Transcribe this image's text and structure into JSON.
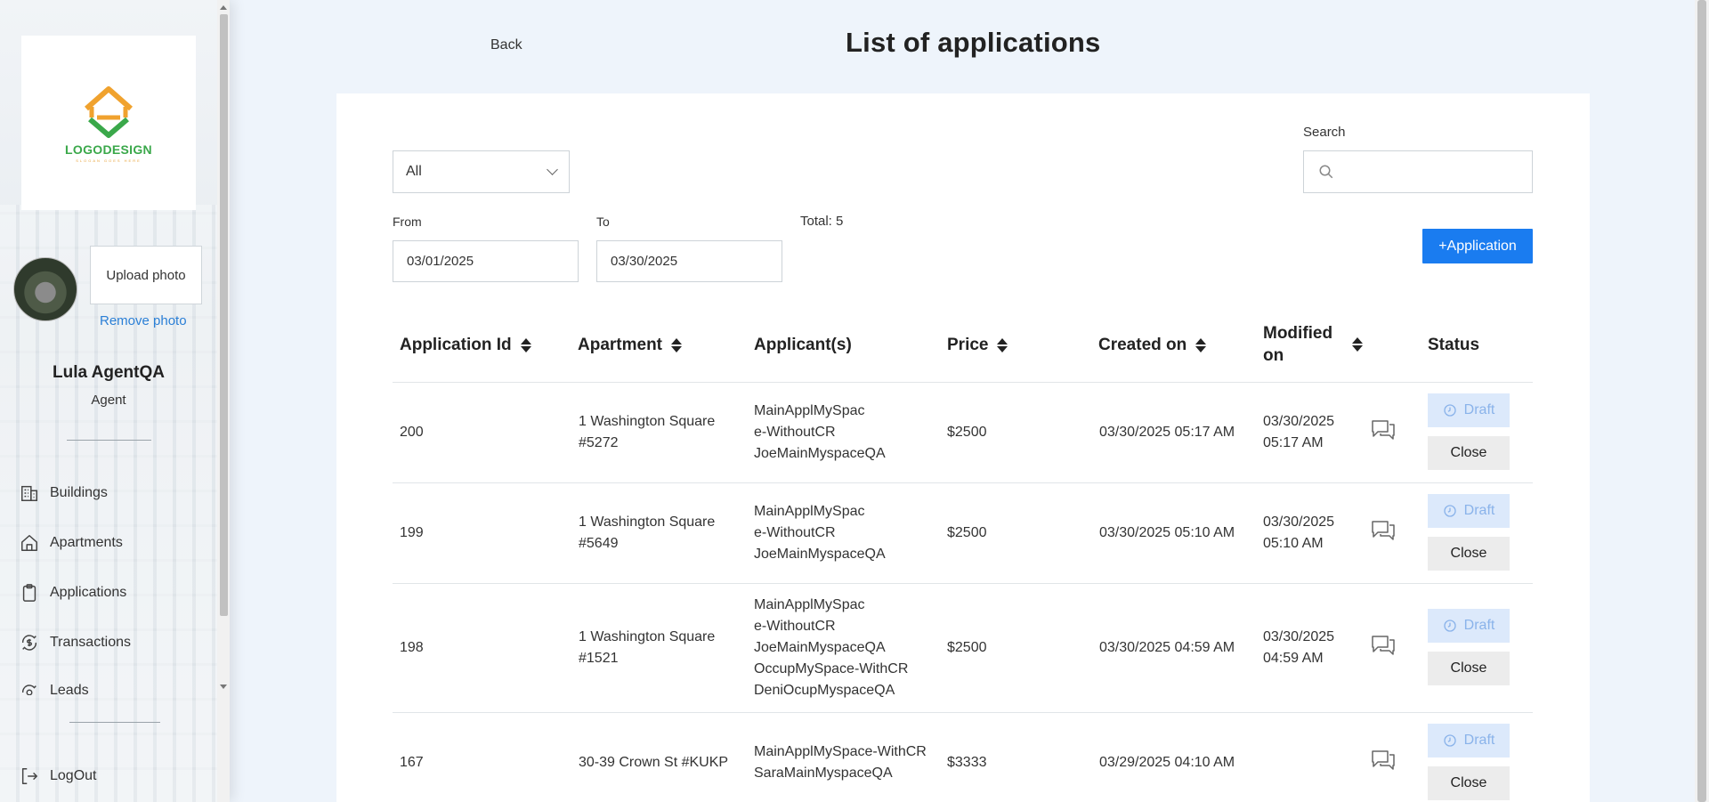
{
  "sidebar": {
    "logo_text": "LOGODESIGN",
    "logo_sub": "SLOGAN GOES HERE",
    "upload_label": "Upload photo",
    "remove_label": "Remove photo",
    "user_name": "Lula AgentQA",
    "user_role": "Agent",
    "nav": [
      {
        "label": "Buildings",
        "icon": "building-icon"
      },
      {
        "label": "Apartments",
        "icon": "home-icon"
      },
      {
        "label": "Applications",
        "icon": "clipboard-icon"
      },
      {
        "label": "Transactions",
        "icon": "dollar-cycle-icon"
      },
      {
        "label": "Leads",
        "icon": "leads-icon"
      }
    ],
    "logout_label": "LogOut"
  },
  "header": {
    "back_label": "Back",
    "title": "List of applications"
  },
  "filters": {
    "status_selected": "All",
    "from_label": "From",
    "from_value": "03/01/2025",
    "to_label": "To",
    "to_value": "03/30/2025",
    "total_text": "Total: 5",
    "search_label": "Search",
    "search_value": "",
    "add_button_label": "+Application"
  },
  "table": {
    "headers": {
      "id": "Application Id",
      "apartment": "Apartment",
      "applicants": "Applicant(s)",
      "price": "Price",
      "created": "Created on",
      "modified": "Modified on",
      "status": "Status"
    },
    "rows": [
      {
        "id": "200",
        "apartment": "1 Washington Square #5272",
        "applicants": [
          "MainApplMySpace-WithoutCR",
          "JoeMainMyspaceQA"
        ],
        "price": "$2500",
        "created": "03/30/2025 05:17 AM",
        "modified": "03/30/2025 05:17 AM",
        "status": "Draft",
        "action": "Close"
      },
      {
        "id": "199",
        "apartment": "1 Washington Square #5649",
        "applicants": [
          "MainApplMySpace-WithoutCR",
          "JoeMainMyspaceQA"
        ],
        "price": "$2500",
        "created": "03/30/2025 05:10 AM",
        "modified": "03/30/2025 05:10 AM",
        "status": "Draft",
        "action": "Close"
      },
      {
        "id": "198",
        "apartment": "1 Washington Square #1521",
        "applicants": [
          "MainApplMySpace-WithoutCR",
          "JoeMainMyspaceQA",
          "OccupMySpace-WithCR",
          "DeniOcupMyspaceQA"
        ],
        "price": "$2500",
        "created": "03/30/2025 04:59 AM",
        "modified": "03/30/2025 04:59 AM",
        "status": "Draft",
        "action": "Close"
      },
      {
        "id": "167",
        "apartment": "30-39 Crown St #KUKP",
        "applicants": [
          "MainApplMySpace-WithCR",
          "SaraMainMyspaceQA"
        ],
        "price": "$3333",
        "created": "03/29/2025 04:10 AM",
        "modified": "",
        "status": "Draft",
        "action": "Close"
      }
    ]
  },
  "colors": {
    "accent": "#1a7cf0",
    "draft_bg": "#dce9fb",
    "draft_text": "#8ab3ea",
    "logo_green": "#3aa84a",
    "logo_orange": "#f0a22e"
  }
}
